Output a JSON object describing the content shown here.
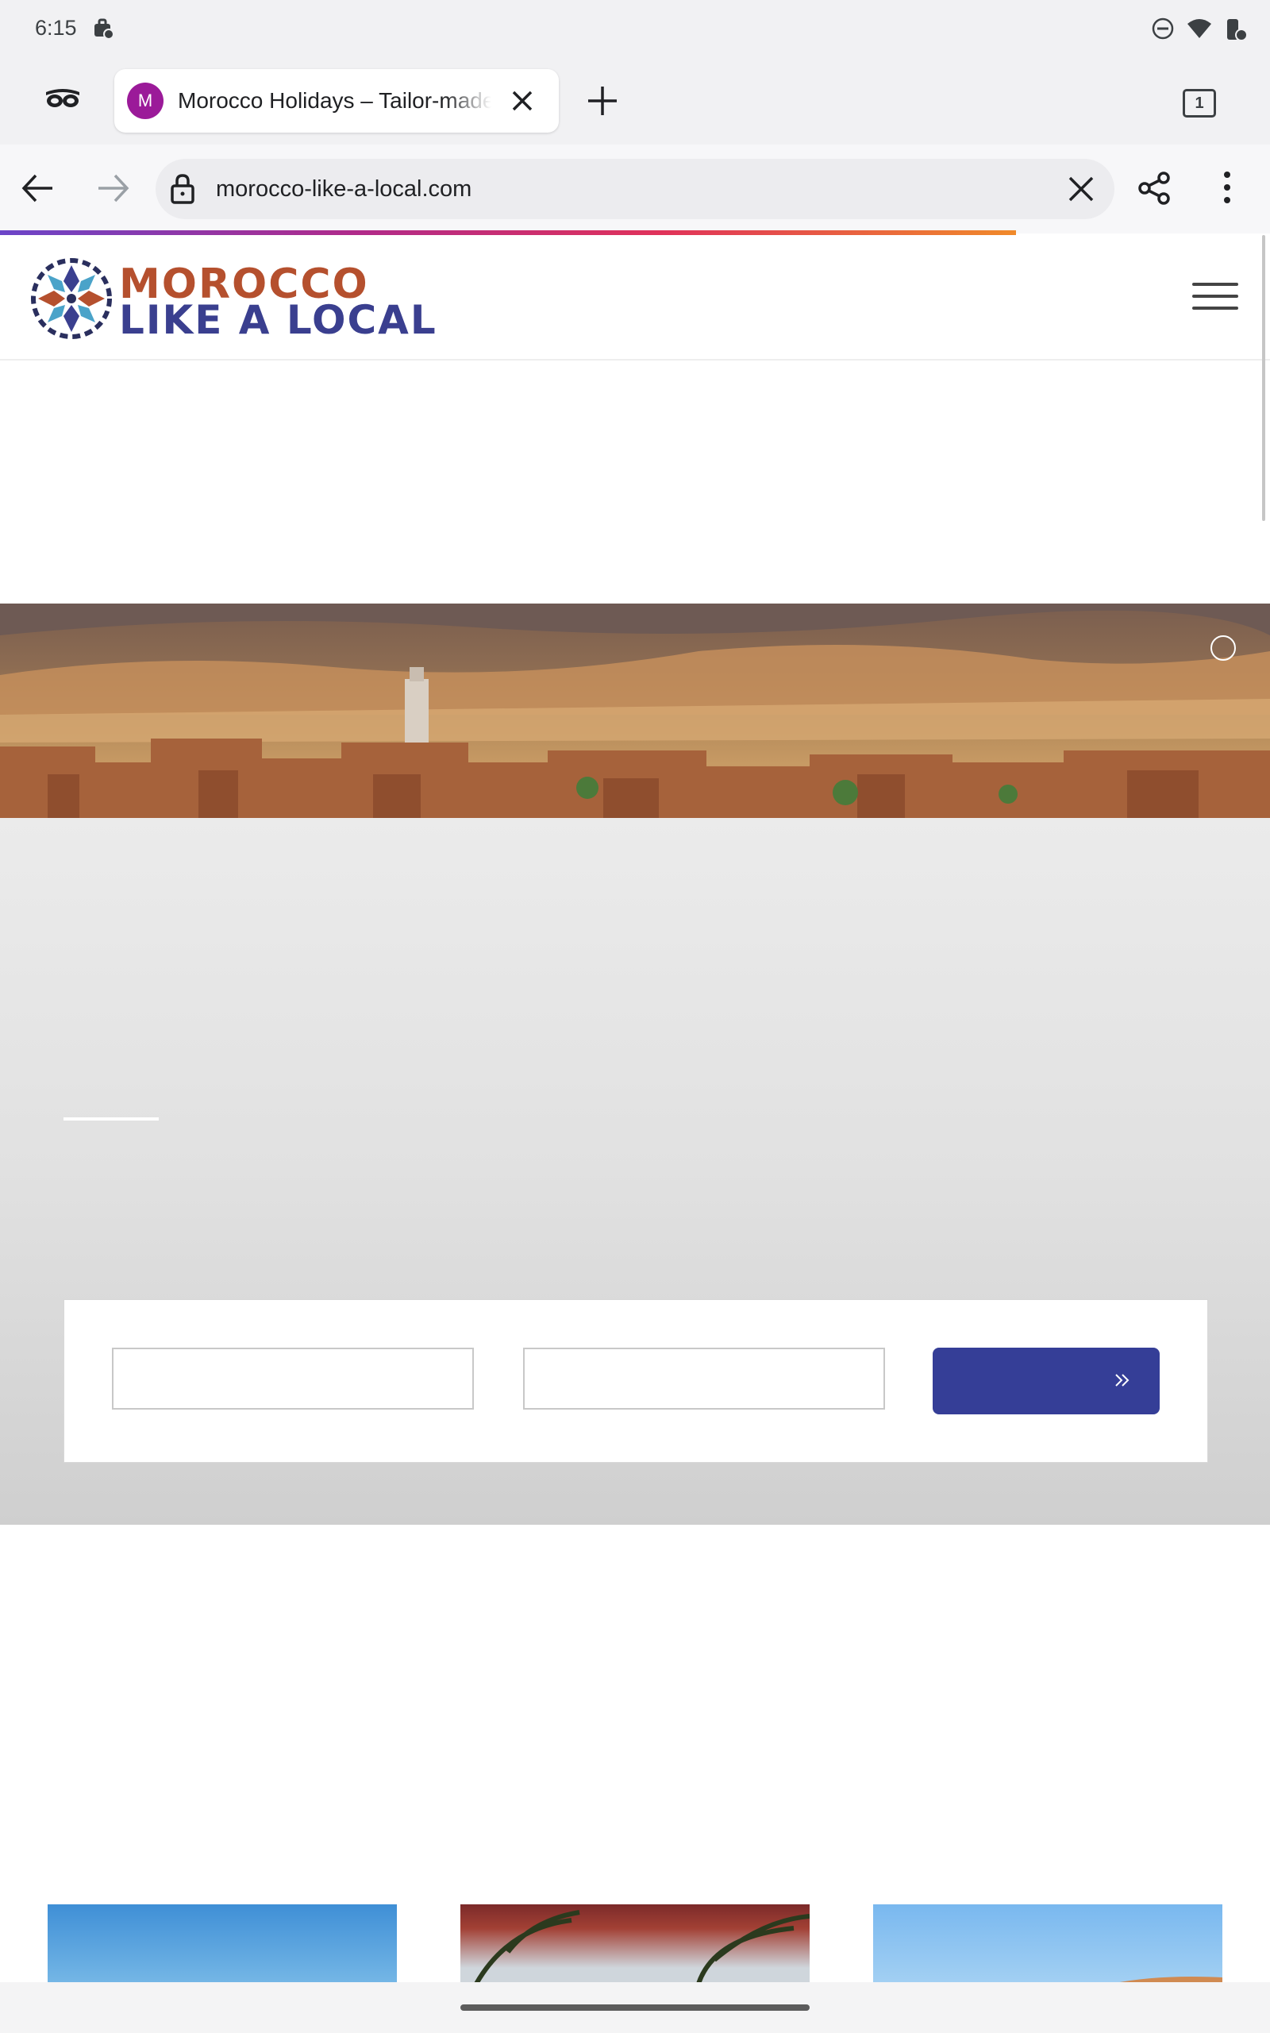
{
  "status_bar": {
    "time": "6:15",
    "icons": [
      "work-bag-icon",
      "do-not-disturb-icon",
      "wifi-icon",
      "work-battery-icon"
    ]
  },
  "tab_strip": {
    "incognito_icon": "incognito-icon",
    "tab": {
      "favicon_letter": "M",
      "favicon_color": "#9b1a99",
      "title": "Morocco Holidays – Tailor-made"
    },
    "tab_count": "1"
  },
  "toolbar": {
    "url": "morocco-like-a-local.com"
  },
  "page": {
    "logo": {
      "line1": "MOROCCO",
      "line2": "LIKE A LOCAL"
    },
    "colors": {
      "brand_red": "#b5502e",
      "brand_blue": "#3a3f8f",
      "button_blue": "#353e97"
    },
    "search_form": {
      "field1_value": "",
      "field2_value": "",
      "button_label": ""
    }
  }
}
